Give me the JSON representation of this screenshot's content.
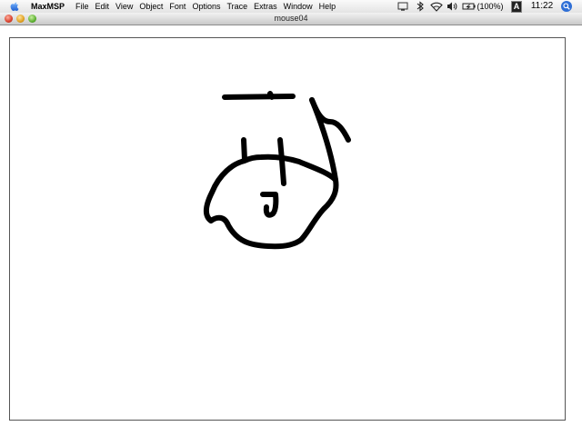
{
  "menubar": {
    "app_name": "MaxMSP",
    "menus": [
      "File",
      "Edit",
      "View",
      "Object",
      "Font",
      "Options",
      "Trace",
      "Extras",
      "Window",
      "Help"
    ],
    "battery": "(100%)",
    "input_menu": "A",
    "clock": "11:22"
  },
  "window": {
    "title": "mouse04"
  },
  "icons": {
    "apple": "apple-icon",
    "status": [
      "screen-icon",
      "bluetooth-icon",
      "wifi-icon",
      "volume-icon",
      "battery-icon",
      "spotlight-icon"
    ]
  }
}
